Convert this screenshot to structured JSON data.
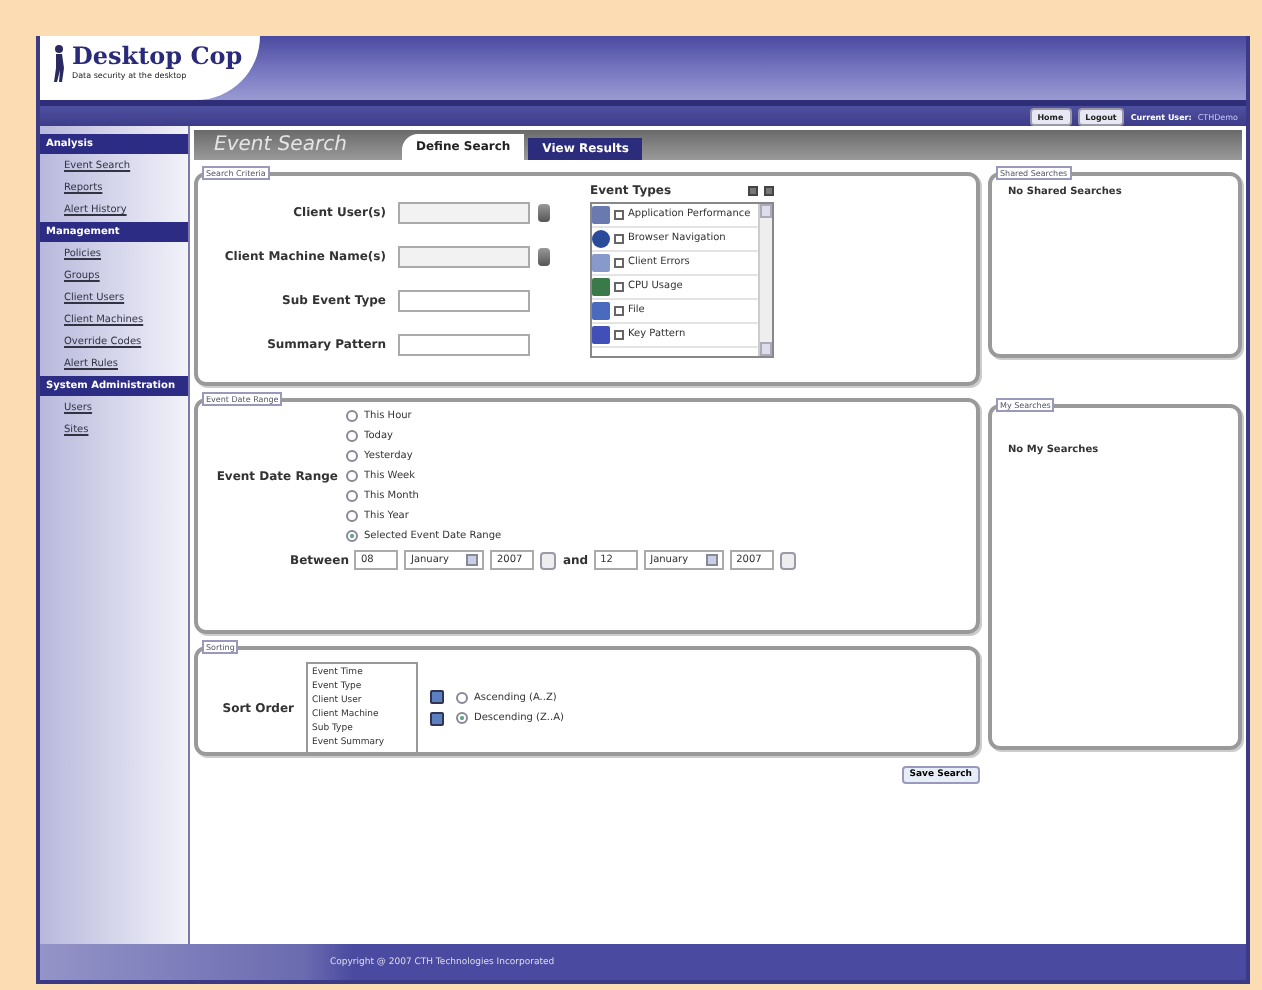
{
  "header": {
    "logo": "Desktop Cop",
    "tagline": "Data security at the desktop",
    "buttons": [
      "Home",
      "Logout"
    ],
    "current_user_label": "Current User:",
    "current_user": "CTHDemo"
  },
  "sidebar": {
    "sections": [
      {
        "title": "Analysis",
        "items": [
          {
            "label": "Event Search"
          },
          {
            "label": "Reports"
          },
          {
            "label": "Alert History"
          }
        ]
      },
      {
        "title": "Management",
        "items": [
          {
            "label": "Policies"
          },
          {
            "label": "Groups"
          },
          {
            "label": "Client Users"
          },
          {
            "label": "Client Machines"
          },
          {
            "label": "Override Codes"
          },
          {
            "label": "Alert Rules"
          }
        ]
      },
      {
        "title": "System Administration",
        "items": [
          {
            "label": "Users"
          },
          {
            "label": "Sites"
          }
        ]
      }
    ]
  },
  "page_title": "Event Search",
  "tabs": [
    {
      "label": "Define Search",
      "selected": true
    },
    {
      "label": "View Results",
      "selected": false
    }
  ],
  "search_criteria": {
    "legend": "Search Criteria",
    "fields": [
      {
        "label": "Client User(s)",
        "kind": "picker"
      },
      {
        "label": "Client Machine Name(s)",
        "kind": "picker"
      },
      {
        "label": "Sub Event Type",
        "kind": "text"
      },
      {
        "label": "Summary Pattern",
        "kind": "text"
      }
    ],
    "event_types": {
      "label": "Event Types",
      "items": [
        {
          "label": "Application Performance",
          "checked": false
        },
        {
          "label": "Browser Navigation",
          "checked": false
        },
        {
          "label": "Client Errors",
          "checked": false
        },
        {
          "label": "CPU Usage",
          "checked": false
        },
        {
          "label": "File",
          "checked": false
        },
        {
          "label": "Key Pattern",
          "checked": false
        }
      ]
    }
  },
  "date_range": {
    "legend": "Event Date Range",
    "label": "Event Date Range",
    "options": [
      {
        "label": "This Hour",
        "selected": false
      },
      {
        "label": "Today",
        "selected": false
      },
      {
        "label": "Yesterday",
        "selected": false
      },
      {
        "label": "This Week",
        "selected": false
      },
      {
        "label": "This Month",
        "selected": false
      },
      {
        "label": "This Year",
        "selected": false
      },
      {
        "label": "Selected Event Date Range",
        "selected": true
      }
    ],
    "between_label": "Between",
    "and_label": "and",
    "from": {
      "day": "08",
      "month": "January",
      "year": "2007"
    },
    "to": {
      "day": "12",
      "month": "January",
      "year": "2007"
    }
  },
  "sorting": {
    "legend": "Sorting",
    "label": "Sort Order",
    "columns": [
      "Event Time",
      "Event Type",
      "Client User",
      "Client Machine",
      "Sub Type",
      "Event Summary"
    ],
    "directions": [
      {
        "label": "Ascending (A..Z)",
        "selected": false
      },
      {
        "label": "Descending (Z..A)",
        "selected": true
      }
    ]
  },
  "save_button": "Save Search",
  "shared_searches": {
    "legend": "Shared Searches",
    "empty": "No Shared Searches"
  },
  "my_searches": {
    "legend": "My Searches",
    "empty": "No My Searches"
  },
  "footer": "Copyright @ 2007 CTH Technologies Incorporated"
}
